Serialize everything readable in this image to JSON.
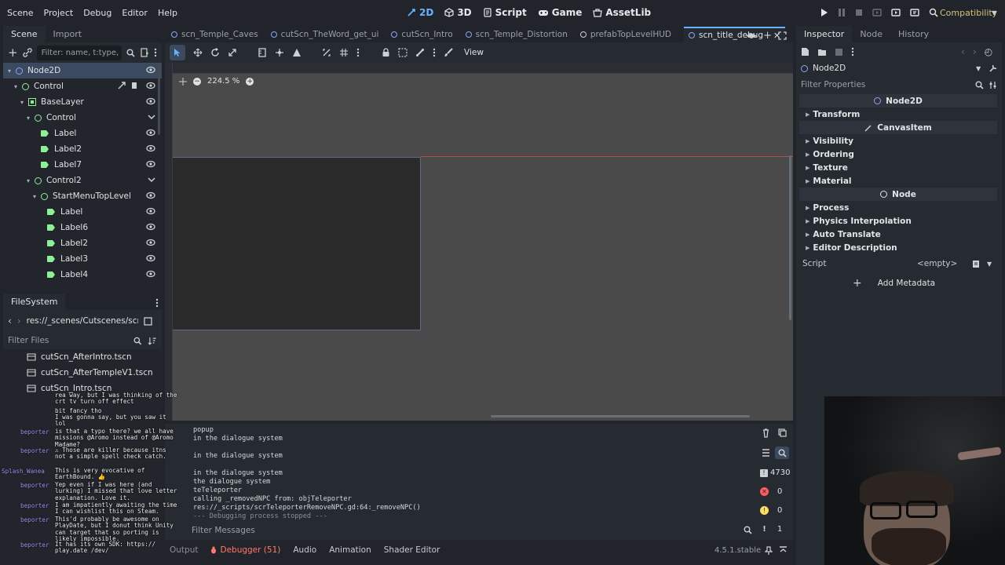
{
  "menu": [
    "Scene",
    "Project",
    "Debug",
    "Editor",
    "Help"
  ],
  "workspaces": [
    {
      "label": "2D",
      "active": true
    },
    {
      "label": "3D",
      "active": false
    },
    {
      "label": "Script",
      "active": false
    },
    {
      "label": "Game",
      "active": false
    },
    {
      "label": "AssetLib",
      "active": false
    }
  ],
  "renderer": "Compatibility",
  "scene_dock": {
    "tabs": [
      "Scene",
      "Import"
    ],
    "filter_placeholder": "Filter: name, t:type, g",
    "tree": [
      {
        "label": "Node2D",
        "indent": 0,
        "icon": "node2d",
        "arrow": "▾",
        "selected": true
      },
      {
        "label": "Control",
        "indent": 1,
        "icon": "control",
        "arrow": "▾",
        "extra": true
      },
      {
        "label": "BaseLayer",
        "indent": 2,
        "icon": "canvaslayer",
        "arrow": "▾"
      },
      {
        "label": "Control",
        "indent": 3,
        "icon": "control",
        "arrow": "▾",
        "fold": true
      },
      {
        "label": "Label",
        "indent": 4,
        "icon": "label",
        "arrow": ""
      },
      {
        "label": "Label2",
        "indent": 4,
        "icon": "label",
        "arrow": ""
      },
      {
        "label": "Label7",
        "indent": 4,
        "icon": "label",
        "arrow": ""
      },
      {
        "label": "Control2",
        "indent": 3,
        "icon": "control",
        "arrow": "▾",
        "fold": true
      },
      {
        "label": "StartMenuTopLevel",
        "indent": 4,
        "icon": "control",
        "arrow": "▾"
      },
      {
        "label": "Label",
        "indent": 5,
        "icon": "label",
        "arrow": ""
      },
      {
        "label": "Label6",
        "indent": 5,
        "icon": "label",
        "arrow": ""
      },
      {
        "label": "Label2",
        "indent": 5,
        "icon": "label",
        "arrow": ""
      },
      {
        "label": "Label3",
        "indent": 5,
        "icon": "label",
        "arrow": ""
      },
      {
        "label": "Label4",
        "indent": 5,
        "icon": "label",
        "arrow": ""
      }
    ]
  },
  "filesystem": {
    "title": "FileSystem",
    "path": "res://_scenes/Cutscenes/scn_tit",
    "filter_placeholder": "Filter Files",
    "files": [
      "cutScn_AfterIntro.tscn",
      "cutScn_AfterTempleV1.tscn",
      "cutScn_Intro.tscn"
    ]
  },
  "editor_tabs": [
    {
      "label": "scn_Temple_Caves",
      "active": false
    },
    {
      "label": "cutScn_TheWord_get_ui",
      "active": false
    },
    {
      "label": "cutScn_Intro",
      "active": false
    },
    {
      "label": "scn_Temple_Distortion",
      "active": false
    },
    {
      "label": "prefabTopLevelHUD",
      "active": false
    },
    {
      "label": "scn_title_debug",
      "active": true
    }
  ],
  "toolbar": {
    "view_label": "View"
  },
  "zoom": "224.5 %",
  "console_lines": [
    "popup",
    "in the dialogue system",
    "",
    "in the dialogue system",
    "",
    "in the dialogue system",
    "the dialogue system",
    "teTeleporter",
    "calling _removedNPC from: objTeleporter",
    "res://_scripts/scrTeleporterRemoveNPC.gd:64:_removeNPC()",
    "--- Debugging process stopped ---"
  ],
  "console_counts": {
    "messages": "4730",
    "errors": "0",
    "warnings": "0",
    "info": "1"
  },
  "filter_messages_placeholder": "Filter Messages",
  "bottom_tabs": [
    "Output",
    "Debugger (51)",
    "Audio",
    "Animation",
    "Shader Editor"
  ],
  "version": "4.5.1.stable",
  "inspector": {
    "tabs": [
      "Inspector",
      "Node",
      "History"
    ],
    "node_name": "Node2D",
    "filter_placeholder": "Filter Properties",
    "sections": [
      {
        "type": "header",
        "label": "Node2D",
        "icon": "node2d"
      },
      {
        "type": "group",
        "label": "Transform"
      },
      {
        "type": "header",
        "label": "CanvasItem",
        "icon": "pen"
      },
      {
        "type": "group",
        "label": "Visibility"
      },
      {
        "type": "group",
        "label": "Ordering"
      },
      {
        "type": "group",
        "label": "Texture"
      },
      {
        "type": "group",
        "label": "Material"
      },
      {
        "type": "header",
        "label": "Node",
        "icon": "node"
      },
      {
        "type": "group",
        "label": "Process"
      },
      {
        "type": "group",
        "label": "Physics Interpolation"
      },
      {
        "type": "group",
        "label": "Auto Translate"
      },
      {
        "type": "group",
        "label": "Editor Description"
      }
    ],
    "script_label": "Script",
    "script_value": "<empty>",
    "add_metadata": "Add Metadata"
  },
  "chat": [
    {
      "user": "",
      "text": "rea way, but I was thinking of the\ncrt tv turn off effect"
    },
    {
      "user": "",
      "text": "bit fancy tho"
    },
    {
      "user": "",
      "text": "I was gonna say, but you saw it\nlol"
    },
    {
      "user": "beporter",
      "text": "is that a typo there? we all have\nmissions @Aromo instead of @Aromo\nMadame?"
    },
    {
      "user": "beporter",
      "text": "⚠ Those are killer because itns\nnot a simple spell check catch."
    },
    {
      "user": "Splash_Wanea",
      "text": "This is very evocative of\nEarthBound. 👍"
    },
    {
      "user": "beporter",
      "text": "Yep even if I was here (and\nlurking) I missed that love letter\nexplanation. Love it."
    },
    {
      "user": "beporter",
      "text": "I am impatiently awaiting the time\nI can wishlist this on Steam."
    },
    {
      "user": "beporter",
      "text": "This'd probably be awesome on\nPlayDate, but I donut think Unity\ncan target that so porting is\nlikely impossible."
    },
    {
      "user": "beporter",
      "text": "It has its own SDK: https://\nplay.date /dev/"
    }
  ],
  "colors": {
    "accent": "#66b3ff",
    "node2d": "#8da5f3",
    "control": "#8eef97",
    "error": "#ff5d5d",
    "warning": "#ffdd65",
    "debugger": "#ff786b"
  }
}
